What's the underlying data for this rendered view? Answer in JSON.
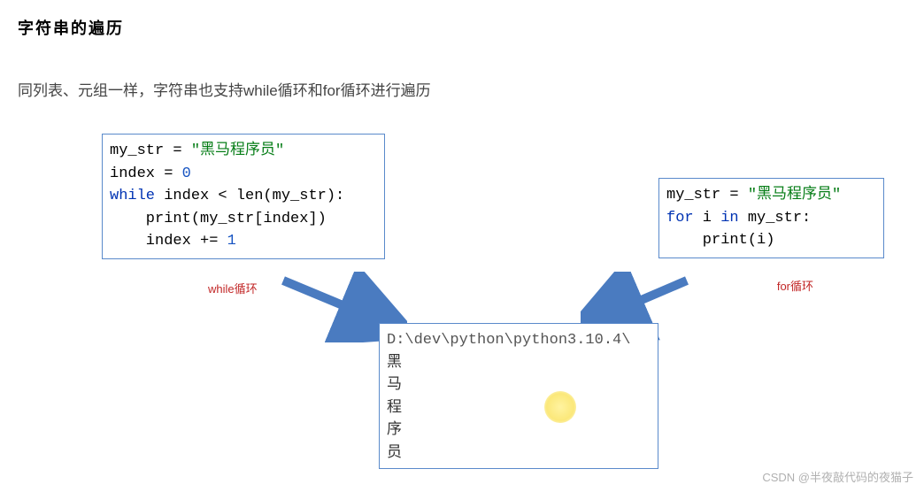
{
  "heading": "字符串的遍历",
  "subtext": "同列表、元组一样，字符串也支持while循环和for循环进行遍历",
  "codeLeft": {
    "line1_lhs": "my_str = ",
    "line1_str": "\"黑马程序员\"",
    "line2_lhs": "index = ",
    "line2_num": "0",
    "line3_kw": "while",
    "line3_rest": " index < len(my_str):",
    "line4": "    print(my_str[index])",
    "line5_lhs": "    index += ",
    "line5_num": "1"
  },
  "codeRight": {
    "line1_lhs": "my_str = ",
    "line1_str": "\"黑马程序员\"",
    "line2_kw": "for",
    "line2_mid": " i ",
    "line2_kw2": "in",
    "line2_rest": " my_str:",
    "line3": "    print(i)"
  },
  "output": {
    "path": "D:\\dev\\python\\python3.10.4\\",
    "l1": "黑",
    "l2": "马",
    "l3": "程",
    "l4": "序",
    "l5": "员"
  },
  "captions": {
    "left": "while循环",
    "right": "for循环"
  },
  "watermark": "CSDN @半夜敲代码的夜猫子"
}
